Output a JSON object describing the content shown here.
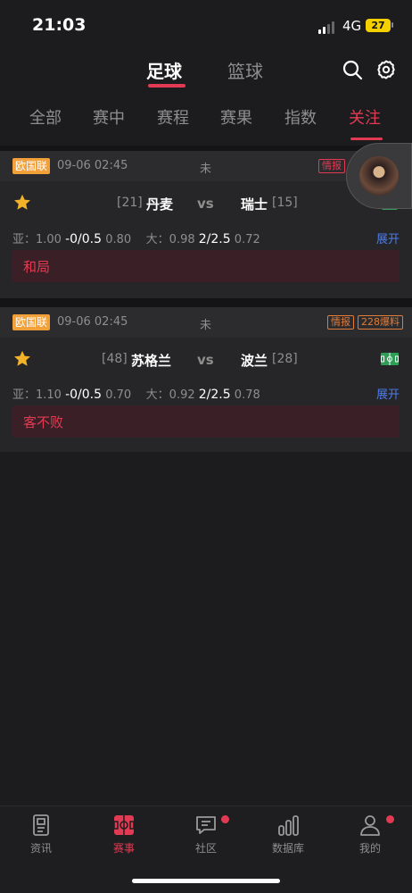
{
  "status_bar": {
    "time": "21:03",
    "network": "4G",
    "battery": "27"
  },
  "sport_tabs": [
    {
      "label": "足球"
    },
    {
      "label": "篮球"
    }
  ],
  "filter_tabs": [
    {
      "label": "全部"
    },
    {
      "label": "赛中"
    },
    {
      "label": "赛程"
    },
    {
      "label": "赛果"
    },
    {
      "label": "指数"
    },
    {
      "label": "关注"
    }
  ],
  "matches": [
    {
      "league": "欧国联",
      "datetime": "09-06 02:45",
      "status": "未",
      "tag_info": "情报",
      "home": {
        "rank": "[21]",
        "name": "丹麦"
      },
      "vs": "vs",
      "away": {
        "name": "瑞士",
        "rank": "[15]"
      },
      "odds": {
        "asia_label": "亚：1.00",
        "asia_line": "-0/0.5",
        "asia_odd": "0.80",
        "big_label": "大：0.98",
        "big_line": "2/2.5",
        "big_odd": "0.72"
      },
      "expand": "展开",
      "prediction": "和局"
    },
    {
      "league": "欧国联",
      "datetime": "09-06 02:45",
      "status": "未",
      "tag_info": "情报",
      "tag_count": "228爆料",
      "home": {
        "rank": "[48]",
        "name": "苏格兰"
      },
      "vs": "vs",
      "away": {
        "name": "波兰",
        "rank": "[28]"
      },
      "odds": {
        "asia_label": "亚：1.10",
        "asia_line": "-0/0.5",
        "asia_odd": "0.70",
        "big_label": "大：0.92",
        "big_line": "2/2.5",
        "big_odd": "0.78"
      },
      "expand": "展开",
      "prediction": "客不败"
    }
  ],
  "bottom_nav": [
    {
      "label": "资讯",
      "icon": "news-icon"
    },
    {
      "label": "赛事",
      "icon": "match-icon"
    },
    {
      "label": "社区",
      "icon": "chat-icon"
    },
    {
      "label": "数据库",
      "icon": "chart-icon"
    },
    {
      "label": "我的",
      "icon": "user-icon"
    }
  ],
  "colors": {
    "accent": "#e23a52",
    "league_badge": "#f2a03a",
    "link": "#4a7cf0",
    "star": "#f2b32a"
  }
}
